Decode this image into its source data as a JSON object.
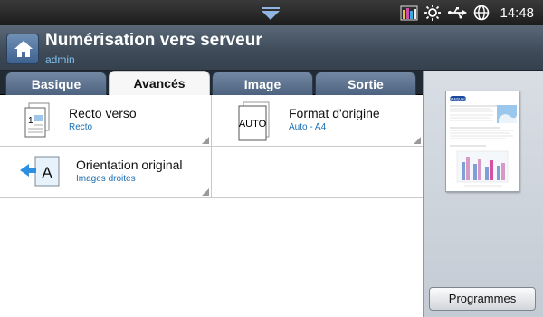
{
  "status_bar": {
    "time": "14:48",
    "icons": [
      "notification-pull-arrow-icon",
      "toner-levels-icon",
      "brightness-icon",
      "usb-icon",
      "network-globe-icon"
    ]
  },
  "header": {
    "title": "Numérisation vers serveur",
    "user": "admin",
    "home_icon": "home-icon"
  },
  "tabs": [
    {
      "label": "Basique",
      "active": false
    },
    {
      "label": "Avancés",
      "active": true
    },
    {
      "label": "Image",
      "active": false
    },
    {
      "label": "Sortie",
      "active": false
    }
  ],
  "options": {
    "duplex": {
      "label": "Recto verso",
      "value": "Recto",
      "icon": "duplex-page-icon"
    },
    "original_size": {
      "label": "Format d'origine",
      "value": "Auto - A4",
      "icon": "auto-size-icon",
      "icon_text": "AUTO"
    },
    "orientation": {
      "label": "Orientation original",
      "value": "Images droites",
      "icon": "orientation-icon",
      "icon_text": "A"
    }
  },
  "preview": {
    "brand": "SAMSUNG",
    "programs_label": "Programmes"
  },
  "colors": {
    "accent_blue": "#1a6fb3",
    "title_bar": "#3e4a58",
    "tab_inactive": "#5e7490"
  }
}
